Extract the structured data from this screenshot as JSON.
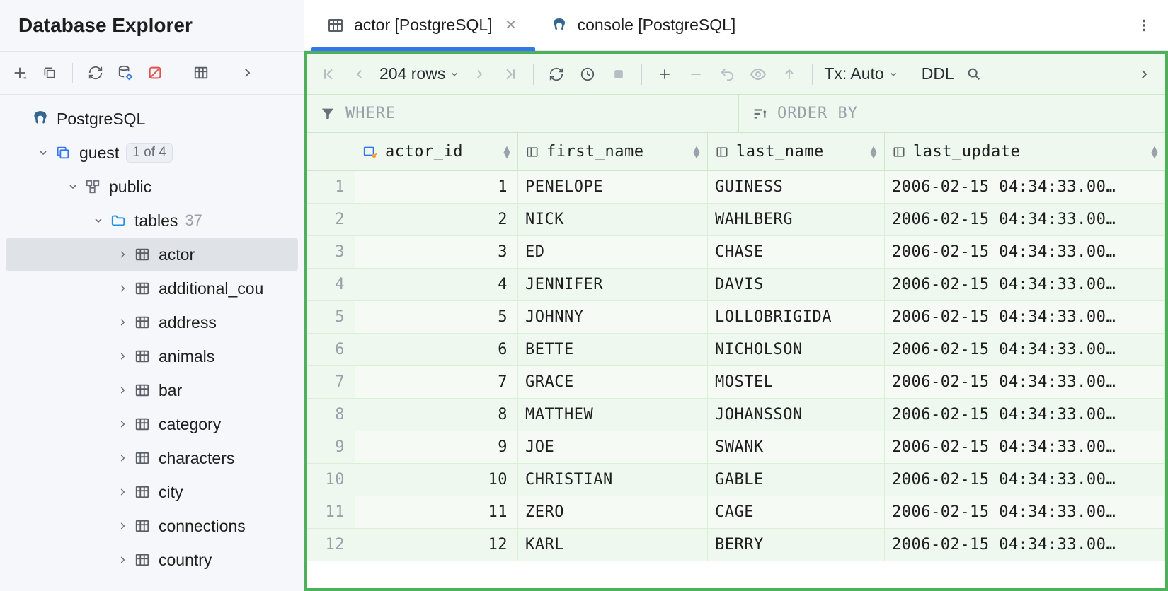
{
  "sidebar": {
    "title": "Database Explorer",
    "datasource": {
      "name": "PostgreSQL"
    },
    "db": {
      "name": "guest",
      "badge": "1 of 4"
    },
    "schema": {
      "name": "public"
    },
    "tables_label": "tables",
    "tables_count": "37",
    "tables": [
      "actor",
      "additional_cou",
      "address",
      "animals",
      "bar",
      "category",
      "characters",
      "city",
      "connections",
      "country"
    ]
  },
  "tabs": {
    "active": {
      "label": "actor [PostgreSQL]"
    },
    "other": {
      "label": "console [PostgreSQL]"
    }
  },
  "grid_toolbar": {
    "rows_label": "204 rows",
    "tx_label": "Tx: Auto",
    "ddl_label": "DDL"
  },
  "filters": {
    "where_label": "WHERE",
    "order_label": "ORDER BY"
  },
  "columns": {
    "c1": "actor_id",
    "c2": "first_name",
    "c3": "last_name",
    "c4": "last_update"
  },
  "rows": [
    {
      "n": "1",
      "id": "1",
      "fn": "PENELOPE",
      "ln": "GUINESS",
      "lu": "2006-02-15 04:34:33.00"
    },
    {
      "n": "2",
      "id": "2",
      "fn": "NICK",
      "ln": "WAHLBERG",
      "lu": "2006-02-15 04:34:33.00"
    },
    {
      "n": "3",
      "id": "3",
      "fn": "ED",
      "ln": "CHASE",
      "lu": "2006-02-15 04:34:33.00"
    },
    {
      "n": "4",
      "id": "4",
      "fn": "JENNIFER",
      "ln": "DAVIS",
      "lu": "2006-02-15 04:34:33.00"
    },
    {
      "n": "5",
      "id": "5",
      "fn": "JOHNNY",
      "ln": "LOLLOBRIGIDA",
      "lu": "2006-02-15 04:34:33.00"
    },
    {
      "n": "6",
      "id": "6",
      "fn": "BETTE",
      "ln": "NICHOLSON",
      "lu": "2006-02-15 04:34:33.00"
    },
    {
      "n": "7",
      "id": "7",
      "fn": "GRACE",
      "ln": "MOSTEL",
      "lu": "2006-02-15 04:34:33.00"
    },
    {
      "n": "8",
      "id": "8",
      "fn": "MATTHEW",
      "ln": "JOHANSSON",
      "lu": "2006-02-15 04:34:33.00"
    },
    {
      "n": "9",
      "id": "9",
      "fn": "JOE",
      "ln": "SWANK",
      "lu": "2006-02-15 04:34:33.00"
    },
    {
      "n": "10",
      "id": "10",
      "fn": "CHRISTIAN",
      "ln": "GABLE",
      "lu": "2006-02-15 04:34:33.00"
    },
    {
      "n": "11",
      "id": "11",
      "fn": "ZERO",
      "ln": "CAGE",
      "lu": "2006-02-15 04:34:33.00"
    },
    {
      "n": "12",
      "id": "12",
      "fn": "KARL",
      "ln": "BERRY",
      "lu": "2006-02-15 04:34:33.00"
    }
  ]
}
